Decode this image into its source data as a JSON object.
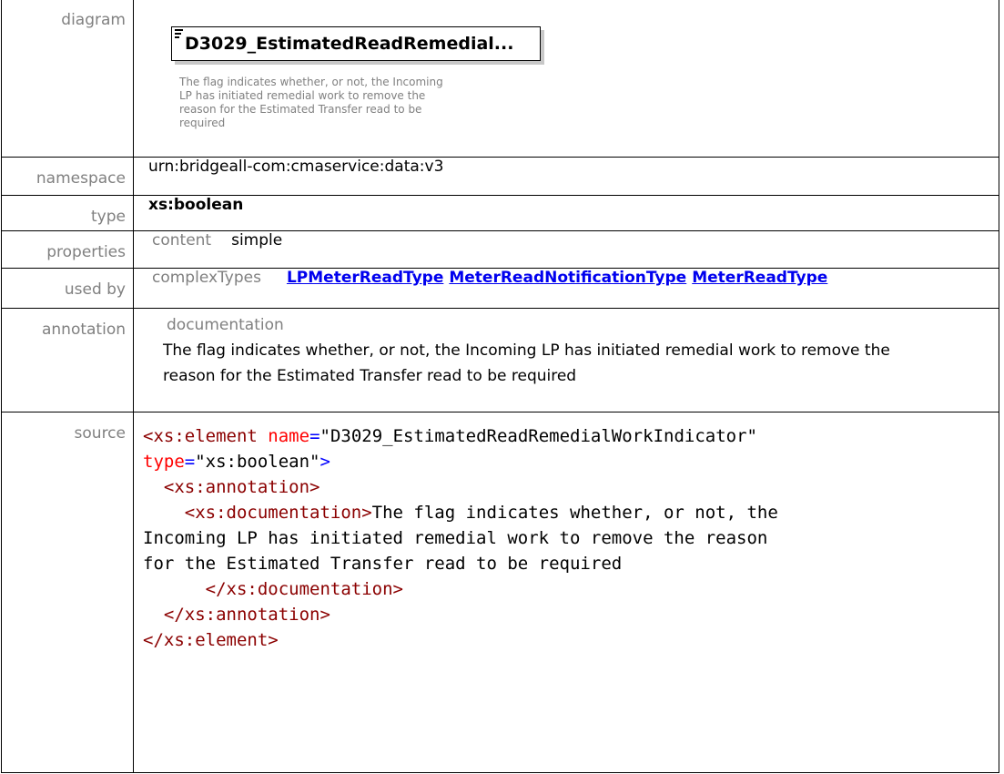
{
  "rows": {
    "diagram": {
      "label": "diagram",
      "element_name": "D3029_EstimatedReadRemedial...",
      "element_doc": "The flag indicates whether, or not, the Incoming LP has initiated remedial work to remove the reason for the Estimated Transfer read to be required"
    },
    "namespace": {
      "label": "namespace",
      "value": "urn:bridgeall-com:cmaservice:data:v3"
    },
    "type": {
      "label": "type",
      "value": "xs:boolean"
    },
    "properties": {
      "label": "properties",
      "key": "content",
      "value": "simple"
    },
    "used_by": {
      "label": "used by",
      "key": "complexTypes",
      "links": [
        "LPMeterReadType",
        "MeterReadNotificationType",
        "MeterReadType"
      ]
    },
    "annotation": {
      "label": "annotation",
      "key": "documentation",
      "value": "The flag indicates whether, or not, the Incoming LP has initiated remedial work to remove the reason for the Estimated Transfer read to be required"
    },
    "source": {
      "label": "source",
      "el_open": "<xs:element",
      "attr_name": "name",
      "val_name": "\"D3029_EstimatedReadRemedialWorkIndicator\"",
      "attr_type": "type",
      "val_type": "\"xs:boolean\"",
      "close_bracket": ">",
      "ann_open": "<xs:annotation>",
      "doc_open": "<xs:documentation>",
      "doc_text_1": "The flag indicates whether, or not, the",
      "doc_text_2": "Incoming LP has initiated remedial work to remove the reason",
      "doc_text_3": "for the Estimated Transfer read to be required",
      "doc_close": "</xs:documentation>",
      "ann_close": "</xs:annotation>",
      "el_close": "</xs:element>",
      "eq": "="
    }
  }
}
